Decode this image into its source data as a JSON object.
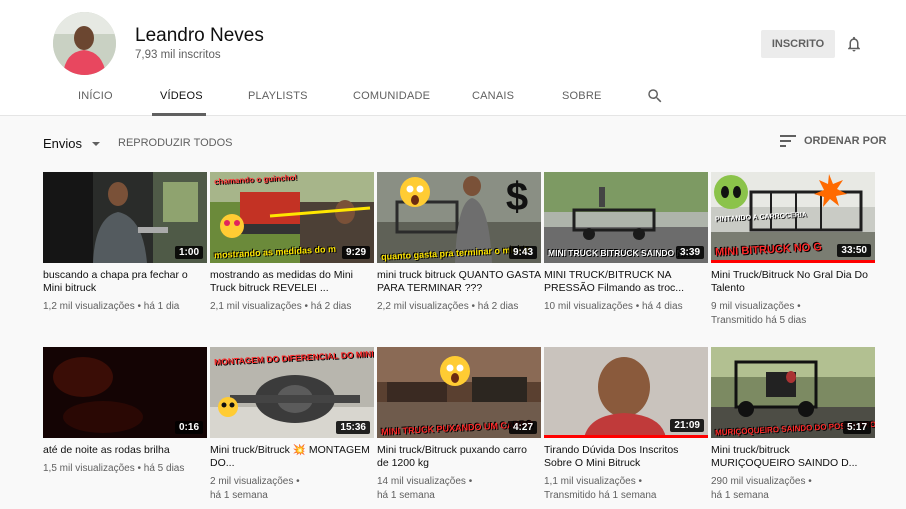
{
  "channel": {
    "name": "Leandro Neves",
    "subscribers": "7,93 mil inscritos",
    "subscribe_label": "INSCRITO"
  },
  "tabs": [
    "INÍCIO",
    "VÍDEOS",
    "PLAYLISTS",
    "COMUNIDADE",
    "CANAIS",
    "SOBRE"
  ],
  "sort_bar": {
    "uploads_label": "Envios",
    "play_all_label": "REPRODUZIR TODOS",
    "order_label": "ORDENAR POR"
  },
  "icons": {
    "bell": "bell-icon",
    "search": "search-icon",
    "sort": "sort-icon",
    "dropdown": "chevron-down-icon"
  },
  "colors": {
    "progress": "#ff0000",
    "meta_text": "#606060",
    "subscribe_bg": "#ececec"
  },
  "videos": [
    {
      "title": "buscando a chapa pra fechar o Mini bitruck",
      "views": "1,2 mil visualizações",
      "age": "há 1 dia",
      "duration": "1:00",
      "overlay": "",
      "overlay_top": ""
    },
    {
      "title": "mostrando as medidas do Mini Truck bitruck REVELEI ...",
      "views": "2,1 mil visualizações",
      "age": "há 2 dias",
      "duration": "9:29",
      "overlay": "mostrando as medidas do m",
      "overlay_top": "chamando o guincho!"
    },
    {
      "title": "mini truck bitruck QUANTO GASTA PARA TERMINAR ???",
      "views": "2,2 mil visualizações",
      "age": "há 2 dias",
      "duration": "9:43",
      "overlay": "quanto gasta pra terminar o mini tr",
      "overlay_top": ""
    },
    {
      "title": "MINI TRUCK/BITRUCK NA PRESSÃO Filmando as troc...",
      "views": "10 mil visualizações",
      "age": "há 4 dias",
      "duration": "3:39",
      "overlay": "MINI TRUCK BITRUCK SAINDO NA P",
      "overlay_top": ""
    },
    {
      "title": "Mini Truck/Bitruck No Gral Dia Do Talento",
      "views": "9 mil visualizações",
      "age": "Transmitido há 5 dias",
      "duration": "33:50",
      "overlay": "MINI BITRUCK NO G",
      "overlay_top": "PINTANDO A CARROCERIA",
      "progress": 1.0
    },
    {
      "title": "até de noite as rodas brilha",
      "views": "1,5 mil visualizações",
      "age": "há 5 dias",
      "duration": "0:16",
      "overlay": "",
      "overlay_top": ""
    },
    {
      "title": "Mini truck/Bitruck 💥 MONTAGEM DO...",
      "views": "2 mil visualizações",
      "age": "há 1 semana",
      "duration": "15:36",
      "overlay": "MONTAGEM DO DIFERENCIAL DO MINI TRUCK",
      "overlay_top": ""
    },
    {
      "title": "Mini truck/Bitruck puxando carro de 1200 kg",
      "views": "14 mil visualizações",
      "age": "há 1 semana",
      "duration": "4:27",
      "overlay": "MINI TRUCK PUXANDO UM CARRO",
      "overlay_top": ""
    },
    {
      "title": "Tirando Dúvida Dos Inscritos Sobre O Mini Bitruck",
      "views": "1,1 mil visualizações",
      "age": "Transmitido há 1 semana",
      "duration": "21:09",
      "overlay": "",
      "overlay_top": "",
      "progress": 1.0
    },
    {
      "title": "Mini truck/bitruck MURIÇOQUEIRO SAINDO D...",
      "views": "290 mil visualizações",
      "age": "há 1 semana",
      "duration": "5:17",
      "overlay": "MURIÇOQUEIRO SAINDO DO POSTO PRO L",
      "overlay_top": ""
    }
  ]
}
